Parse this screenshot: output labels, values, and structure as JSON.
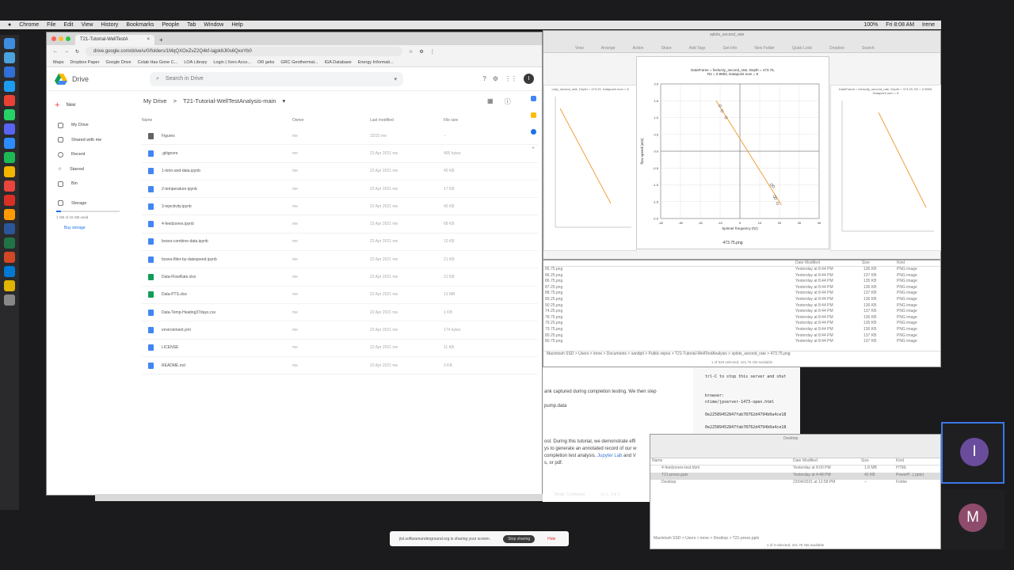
{
  "menubar": {
    "items": [
      "Chrome",
      "File",
      "Edit",
      "View",
      "History",
      "Bookmarks",
      "People",
      "Tab",
      "Window",
      "Help"
    ],
    "status": [
      "100%",
      "Fri 8:08 AM",
      "Irene"
    ]
  },
  "chrome": {
    "tab_title": "T21-Tutorial-WellTestA",
    "url": "drive.google.com/drive/u/0/folders/1MqQXOxZvZ2Q4kf-Iajpk8Jl0s6QxoYb0",
    "bookmarks": [
      "Maps",
      "Dropbox Paper",
      "Google Drive",
      "Colab Has Gone C...",
      "LOA Library",
      "Login | Xero Acco...",
      "OR geks",
      "GRC Geothermal...",
      "IGA Database",
      "Energy Informati..."
    ]
  },
  "drive": {
    "logo_text": "Drive",
    "search_placeholder": "Search in Drive",
    "avatar_letter": "I",
    "new_label": "New",
    "nav": [
      "My Drive",
      "Shared with me",
      "Recent",
      "Starred",
      "Bin",
      "Storage"
    ],
    "storage_text": "1 GB of 15 GB used",
    "buy_storage": "Buy storage",
    "breadcrumb_root": "My Drive",
    "breadcrumb_sep": ">",
    "breadcrumb_folder": "T21-Tutorial-WellTestAnalysis-main",
    "columns": {
      "name": "Name",
      "owner": "Owner",
      "modified": "Last modified",
      "size": "File size"
    },
    "files": [
      {
        "name": "Figures",
        "type": "folder",
        "owner": "me",
        "modified": "22/22 me",
        "size": "–",
        "color": "#5f6368"
      },
      {
        "name": ".gitignore",
        "type": "doc",
        "owner": "me",
        "modified": "22 Apr 2021 me",
        "size": "465 bytes",
        "color": "#4285f4"
      },
      {
        "name": "1-intro-and-data.ipynb",
        "type": "doc",
        "owner": "me",
        "modified": "22 Apr 2021 me",
        "size": "45 KB",
        "color": "#4285f4"
      },
      {
        "name": "2-temperature.ipynb",
        "type": "doc",
        "owner": "me",
        "modified": "22 Apr 2021 me",
        "size": "17 KB",
        "color": "#4285f4"
      },
      {
        "name": "3-injectivity.ipynb",
        "type": "doc",
        "owner": "me",
        "modified": "22 Apr 2021 me",
        "size": "45 KB",
        "color": "#4285f4"
      },
      {
        "name": "4-feedzones.ipynb",
        "type": "doc",
        "owner": "me",
        "modified": "22 Apr 2021 me",
        "size": "68 KB",
        "color": "#4285f4"
      },
      {
        "name": "boxes-combine-data.ipynb",
        "type": "doc",
        "owner": "me",
        "modified": "22 Apr 2021 me",
        "size": "10 KB",
        "color": "#4285f4"
      },
      {
        "name": "boxes-filter-by-datespeed.ipynb",
        "type": "doc",
        "owner": "me",
        "modified": "22 Apr 2021 me",
        "size": "21 KB",
        "color": "#4285f4"
      },
      {
        "name": "Data-FlowRate.xlsx",
        "type": "sheet",
        "owner": "me",
        "modified": "22 Apr 2021 me",
        "size": "21 KB",
        "color": "#0f9d58"
      },
      {
        "name": "Data-PTS.xlsx",
        "type": "sheet",
        "owner": "me",
        "modified": "22 Apr 2021 me",
        "size": "13 MB",
        "color": "#0f9d58"
      },
      {
        "name": "Data-Temp-Heating37days.csv",
        "type": "doc",
        "owner": "me",
        "modified": "22 Apr 2021 me",
        "size": "1 KB",
        "color": "#4285f4"
      },
      {
        "name": "environment.yml",
        "type": "doc",
        "owner": "me",
        "modified": "22 Apr 2021 me",
        "size": "174 bytes",
        "color": "#4285f4"
      },
      {
        "name": "LICENSE",
        "type": "doc",
        "owner": "me",
        "modified": "22 Apr 2021 me",
        "size": "11 KB",
        "color": "#4285f4"
      },
      {
        "name": "README.md",
        "type": "doc",
        "owner": "me",
        "modified": "22 Apr 2021 me",
        "size": "3 KB",
        "color": "#4285f4"
      }
    ]
  },
  "plot_window": {
    "title": "xplots_second_rate",
    "toolbar": [
      "View",
      "Arrange",
      "Action",
      "Share",
      "Add Tags",
      "Get Info",
      "New Folder",
      "Quick Look",
      "Dropbox",
      "Search"
    ],
    "main_title_line1": "DataFrame = fvelocity_second_rate, Depth = 473.75,",
    "main_title_line2": "R2 = 0.9983, Datapoint num = 8",
    "main_xlabel": "Spinner frequency (hz)",
    "main_ylabel": "flow speed (m/s)",
    "main_caption": "473.75.png",
    "left_title": "ocity_second_rate, Depth = 473.25, Datapoint num = 8",
    "right_title": "DataFrame = fvelocity_second_rate, Depth = 473.25, R2 = 0.9983, Datapoint num = 8"
  },
  "chart_data": {
    "type": "scatter",
    "title": "DataFrame = fvelocity_second_rate, Depth = 473.75, R2 = 0.9983, Datapoint num = 8",
    "xlabel": "Spinner frequency (hz)",
    "ylabel": "flow speed (m/s)",
    "xlim": [
      -40,
      40
    ],
    "ylim": [
      -2,
      2
    ],
    "xticks": [
      -40,
      -30,
      -20,
      -10,
      0,
      10,
      20,
      30,
      40
    ],
    "yticks": [
      -2.0,
      -1.5,
      -1.0,
      -0.5,
      0.0,
      0.5,
      1.0,
      1.5,
      2.0
    ],
    "points": [
      {
        "x": -10,
        "y": 1.35
      },
      {
        "x": -9,
        "y": 1.2
      },
      {
        "x": -7,
        "y": 1.0
      },
      {
        "x": 16,
        "y": -1.0
      },
      {
        "x": 17,
        "y": -1.05
      },
      {
        "x": 17.5,
        "y": -1.35
      },
      {
        "x": 18,
        "y": -1.4
      },
      {
        "x": 19,
        "y": -1.55
      }
    ],
    "fit": {
      "x": [
        -12,
        21
      ],
      "y": [
        1.5,
        -1.6
      ]
    },
    "grid": true
  },
  "finder1": {
    "columns": [
      "Date Modified",
      "Size",
      "Kind"
    ],
    "rows": [
      {
        "name": "85.75.png",
        "date": "Yesterday at 8:44 PM",
        "size": "136 KB",
        "kind": "PNG image"
      },
      {
        "name": "86.25.png",
        "date": "Yesterday at 8:44 PM",
        "size": "137 KB",
        "kind": "PNG image"
      },
      {
        "name": "86.75.png",
        "date": "Yesterday at 8:44 PM",
        "size": "135 KB",
        "kind": "PNG image"
      },
      {
        "name": "87.25.png",
        "date": "Yesterday at 8:44 PM",
        "size": "136 KB",
        "kind": "PNG image"
      },
      {
        "name": "88.75.png",
        "date": "Yesterday at 8:44 PM",
        "size": "137 KB",
        "kind": "PNG image"
      },
      {
        "name": "89.25.png",
        "date": "Yesterday at 8:44 PM",
        "size": "136 KB",
        "kind": "PNG image"
      },
      {
        "name": "90.25.png",
        "date": "Yesterday at 8:44 PM",
        "size": "136 KB",
        "kind": "PNG image"
      },
      {
        "name": "74.25.png",
        "date": "Yesterday at 8:44 PM",
        "size": "137 KB",
        "kind": "PNG image"
      },
      {
        "name": "78.75.png",
        "date": "Yesterday at 8:44 PM",
        "size": "136 KB",
        "kind": "PNG image"
      },
      {
        "name": "79.25.png",
        "date": "Yesterday at 8:44 PM",
        "size": "135 KB",
        "kind": "PNG image"
      },
      {
        "name": "79.75.png",
        "date": "Yesterday at 8:44 PM",
        "size": "136 KB",
        "kind": "PNG image"
      },
      {
        "name": "80.25.png",
        "date": "Yesterday at 8:44 PM",
        "size": "137 KB",
        "kind": "PNG image"
      },
      {
        "name": "80.75.png",
        "date": "Yesterday at 8:44 PM",
        "size": "137 KB",
        "kind": "PNG image"
      }
    ],
    "path": "Macintosh SSD > Users > irene > Documents > sandpit > Public-repos > T21-Tutorial-WellTestAnalysis > xplots_second_rate > 473.75.png",
    "status": "1 of 929 selected, 421.76 GB available"
  },
  "jupyter": {
    "lines": [
      "ank captured during completion testing. We then step",
      "",
      "pump.data",
      "",
      "",
      "",
      "",
      "ool. During this tutorial, we demonstrate effi",
      "ys to generate an annotated record of our w",
      "completion test analysis. Jupyter Lab and V",
      "s, or pdf."
    ],
    "link_text": "Jupyter Lab",
    "status_mode": "Mode: Command",
    "status_pos": "Ln 1, Col 1"
  },
  "terminal": {
    "lines": [
      "trl-C to stop this server and shut",
      "",
      "",
      "browser:",
      "ntime/jpserver-1473-open.html",
      "",
      "0e22589452847fab78762d4794b0a4ce18",
      "",
      "0e22589452847fab78762d4794b0a4ce18"
    ]
  },
  "finder2": {
    "title": "Desktop",
    "columns": [
      "Name",
      "Date Modified",
      "Size",
      "Kind"
    ],
    "rows": [
      {
        "name": "4-feedzones-test.html",
        "date": "Yesterday at 8:00 PM",
        "size": "1.8 MB",
        "kind": "HTML"
      },
      {
        "name": "T21-preso.pptx",
        "date": "Yesterday at 4:48 PM",
        "size": "42 KB",
        "kind": "PowerP...(.pptx)",
        "selected": true
      },
      {
        "name": "Desktop",
        "date": "23/04/2021 at 12:58 PM",
        "size": "--",
        "kind": "Folder"
      }
    ],
    "path": "Macintosh SSD > Users > irene > Desktop > T21-preso.pptx",
    "status": "1 of 3 selected, 421.76 GB available"
  },
  "participants": [
    {
      "letter": "I",
      "color": "#6a4c9c"
    },
    {
      "letter": "M",
      "color": "#8e4b6b"
    }
  ],
  "share_bar": {
    "text": "jtsl.softwareunderground.org is sharing your screen.",
    "stop": "Stop sharing",
    "hide": "Hide"
  }
}
